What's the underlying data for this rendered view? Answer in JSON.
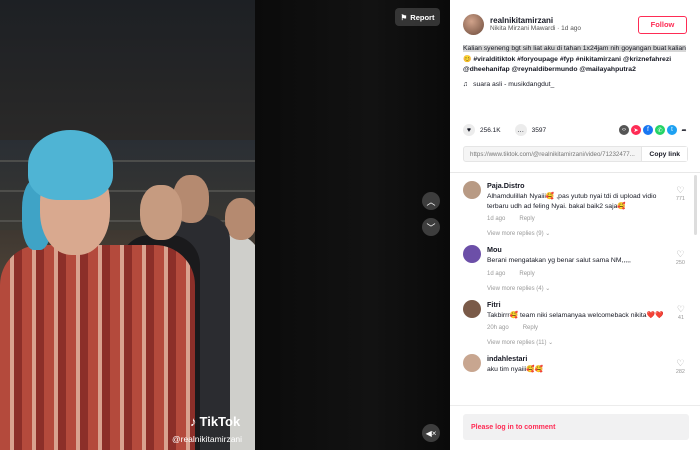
{
  "video": {
    "report_label": "Report",
    "watermark_logo": "TikTok",
    "watermark_handle": "@realnikitamirzani",
    "nav_up_icon": "chevron-up-icon",
    "nav_down_icon": "chevron-down-icon",
    "mute_icon": "mute-icon"
  },
  "author": {
    "username": "realnikitamirzani",
    "display_name": "Nikita Mirzani Mawardi",
    "posted": "1d ago",
    "follow_label": "Follow"
  },
  "caption": {
    "text_highlighted": "Kalian syeneng bgt sih liat aku di tahan 1x24jam nih goyangan buat kalian",
    "emoji": "😊",
    "hashtags": "#viralditiktok #foryoupage #fyp #nikitamirzani",
    "mentions": "@kriznefahrezi @dheehanifap @reynaldibermundo @mailayahputra2",
    "music": "suara asli - musikdangdut_"
  },
  "actions": {
    "likes": "256.1K",
    "comments": "3597"
  },
  "share": {
    "link": "https://www.tiktok.com/@realnikitamirzani/video/71232477...",
    "copy_label": "Copy link"
  },
  "comments": [
    {
      "user": "Paja.Distro",
      "text": "Alhamdulillah Nyaiii🥰 ,pas yutub nyai tdi di upload vidio terbaru udh ad feling Nyai. bakal baik2 saja🥰",
      "time": "1d ago",
      "reply": "Reply",
      "more": "View more replies (9) ⌄",
      "likes": "771",
      "color": "#b89a84"
    },
    {
      "user": "Mou",
      "text": "Berani mengatakan yg benar salut sama NM,,,,,",
      "time": "1d ago",
      "reply": "Reply",
      "more": "View more replies (4) ⌄",
      "likes": "250",
      "color": "#6c4fa8"
    },
    {
      "user": "Fitri",
      "text": "Takbirrr🥰 team niki selamanyaa welcomeback nikita❤️❤️",
      "time": "20h ago",
      "reply": "Reply",
      "more": "View more replies (11) ⌄",
      "likes": "41",
      "color": "#7a5a48"
    },
    {
      "user": "indahlestari",
      "text": "aku tim nyaiii🥰🥰",
      "time": "",
      "reply": "",
      "more": "",
      "likes": "282",
      "color": "#c8a690"
    }
  ],
  "login": {
    "prompt": "Please log in to comment"
  }
}
